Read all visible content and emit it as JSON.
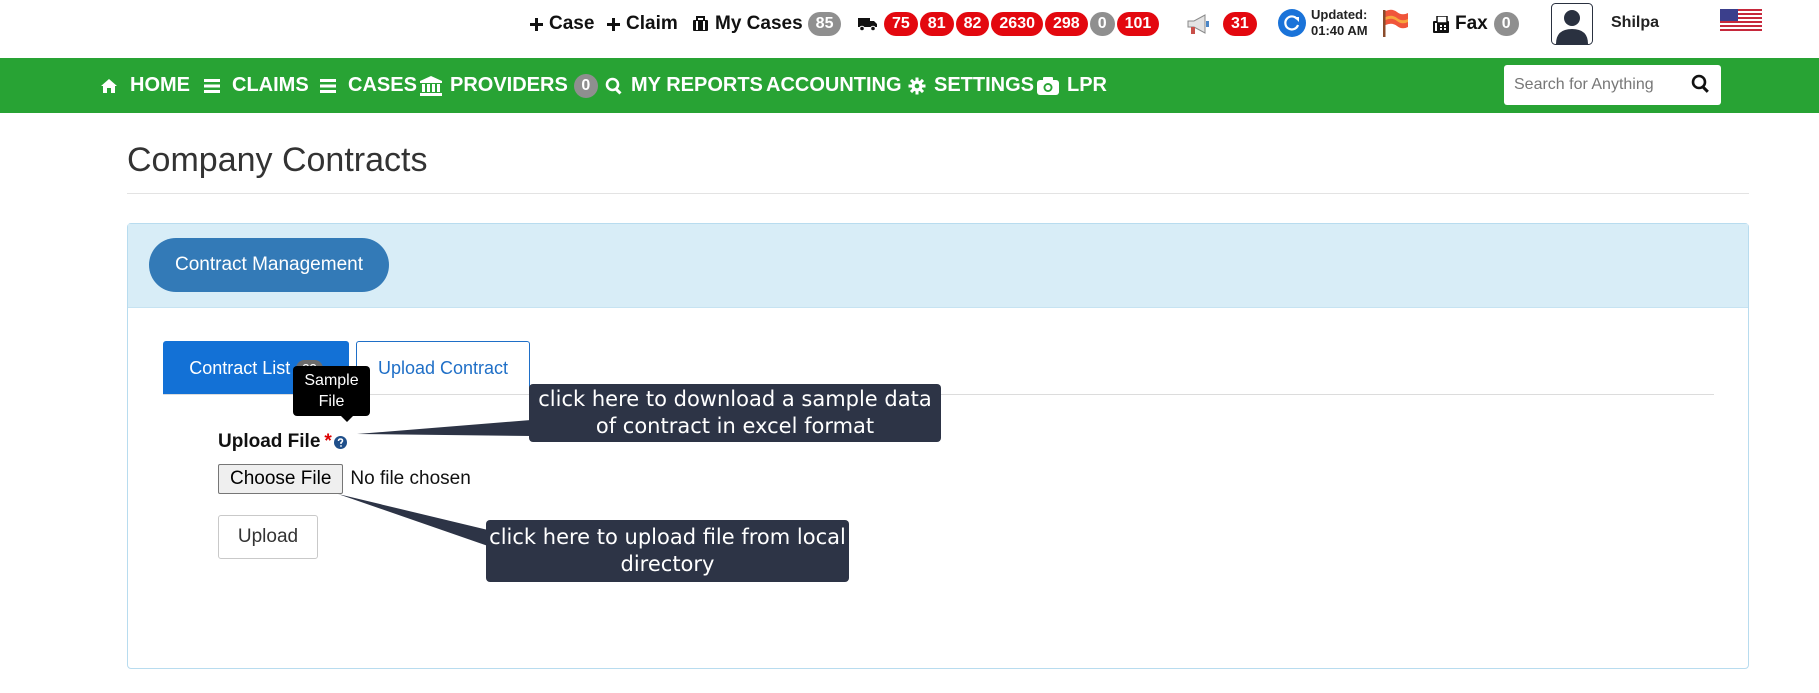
{
  "topbar": {
    "add_case": "Case",
    "add_claim": "Claim",
    "my_cases_label": "My Cases",
    "my_cases_count": "85",
    "truck_counts": [
      {
        "value": "75",
        "color": "red"
      },
      {
        "value": "81",
        "color": "red"
      },
      {
        "value": "82",
        "color": "red"
      },
      {
        "value": "2630",
        "color": "red"
      },
      {
        "value": "298",
        "color": "red"
      },
      {
        "value": "0",
        "color": "grey"
      },
      {
        "value": "101",
        "color": "red"
      }
    ],
    "announcements_count": "31",
    "updated_label": "Updated:",
    "updated_time": "01:40 AM",
    "fax_label": "Fax",
    "fax_count": "0",
    "user_name": "Shilpa",
    "icons": [
      "plus-icon",
      "briefcase-icon",
      "truck-icon",
      "megaphone-icon",
      "refresh-icon",
      "flag-icon",
      "fax-icon",
      "avatar-icon",
      "us-flag-icon"
    ]
  },
  "nav": {
    "items": [
      {
        "label": "HOME",
        "icon": "home-icon"
      },
      {
        "label": "CLAIMS",
        "icon": "list-icon"
      },
      {
        "label": "CASES",
        "icon": "list-icon"
      },
      {
        "label": "PROVIDERS",
        "icon": "bank-icon",
        "badge": "0"
      },
      {
        "label": "MY REPORTS",
        "icon": "search-icon"
      },
      {
        "label": "ACCOUNTING"
      },
      {
        "label": "SETTINGS",
        "icon": "gear-icon"
      },
      {
        "label": "LPR",
        "icon": "camera-icon"
      }
    ],
    "search_placeholder": "Search for Anything"
  },
  "page": {
    "title": "Company Contracts",
    "panel_button": "Contract Management",
    "tabs": {
      "contract_list": "Contract List",
      "contract_list_count": "23",
      "upload_contract": "Upload Contract"
    },
    "upload_label": "Upload File",
    "required_mark": "*",
    "choose_file": "Choose File",
    "no_file": "No file chosen",
    "upload_button": "Upload"
  },
  "annotations": {
    "tooltip_line1": "Sample",
    "tooltip_line2": "File",
    "callout_sample": "click here to download a sample data of contract in excel format",
    "callout_upload": "click here to upload file from local directory"
  },
  "colors": {
    "nav_green": "#28a334",
    "badge_red": "#e3080f",
    "badge_grey": "#8f8f8f",
    "primary_blue": "#337ab7",
    "callout_bg": "#2d3446"
  }
}
